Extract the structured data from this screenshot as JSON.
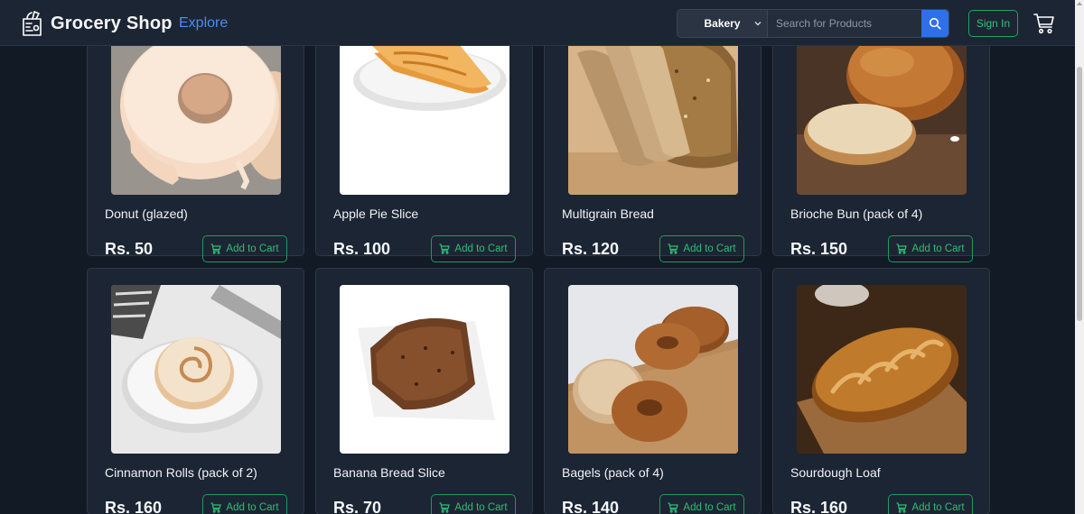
{
  "navbar": {
    "brand_name": "Grocery Shop",
    "brand_icon": "grocery-bag-icon",
    "explore_label": "Explore",
    "category_selected": "Bakery",
    "search_placeholder": "Search for Products",
    "signin_label": "Sign In",
    "cart_icon": "shopping-cart-icon",
    "accent_color": "#2f6fe9",
    "success_color": "#21a363"
  },
  "products": [
    {
      "name": "Donut (glazed)",
      "price": "Rs. 50",
      "button": "Add to Cart",
      "image": "glazed-donut"
    },
    {
      "name": "Apple Pie Slice",
      "price": "Rs. 100",
      "button": "Add to Cart",
      "image": "apple-pie-slice"
    },
    {
      "name": "Multigrain Bread",
      "price": "Rs. 120",
      "button": "Add to Cart",
      "image": "multigrain-bread"
    },
    {
      "name": "Brioche Bun (pack of 4)",
      "price": "Rs. 150",
      "button": "Add to Cart",
      "image": "brioche-bun"
    },
    {
      "name": "Cinnamon Rolls (pack of 2)",
      "price": "Rs. 160",
      "button": "Add to Cart",
      "image": "cinnamon-roll"
    },
    {
      "name": "Banana Bread Slice",
      "price": "Rs. 70",
      "button": "Add to Cart",
      "image": "banana-bread-slice"
    },
    {
      "name": "Bagels (pack of 4)",
      "price": "Rs. 140",
      "button": "Add to Cart",
      "image": "bagels"
    },
    {
      "name": "Sourdough Loaf",
      "price": "Rs. 160",
      "button": "Add to Cart",
      "image": "sourdough-loaf"
    }
  ]
}
